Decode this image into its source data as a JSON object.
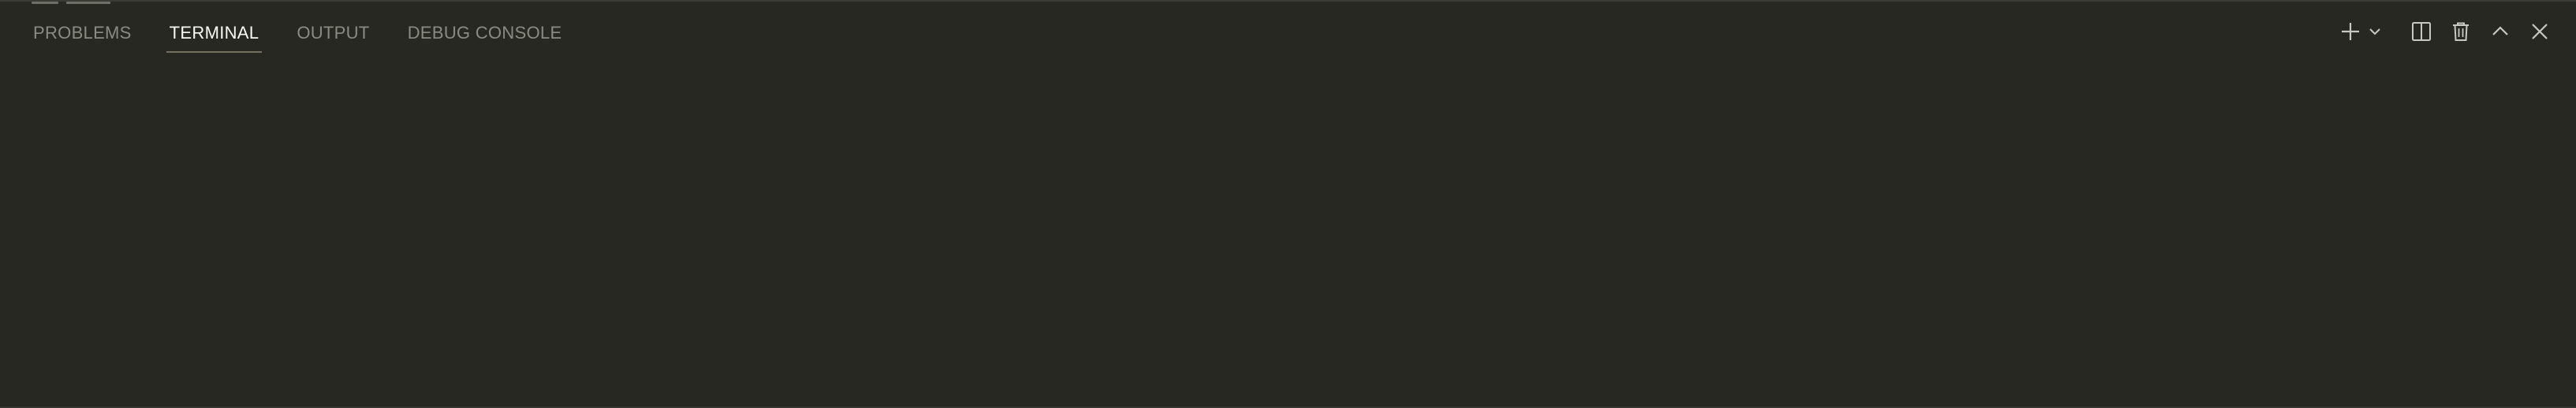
{
  "panel": {
    "tabs": [
      {
        "label": "PROBLEMS",
        "active": false
      },
      {
        "label": "TERMINAL",
        "active": true
      },
      {
        "label": "OUTPUT",
        "active": false
      },
      {
        "label": "DEBUG CONSOLE",
        "active": false
      }
    ]
  },
  "toolbar": {
    "icons": [
      "plus-icon",
      "chevron-down-icon",
      "split-icon",
      "trash-icon",
      "chevron-up-icon",
      "close-icon"
    ]
  },
  "colors": {
    "background": "#272822",
    "active_tab_text": "#f8f8f2",
    "inactive_tab_text": "#8a8b82",
    "active_tab_underline": "#75715e",
    "icon": "#c9c9c2"
  }
}
